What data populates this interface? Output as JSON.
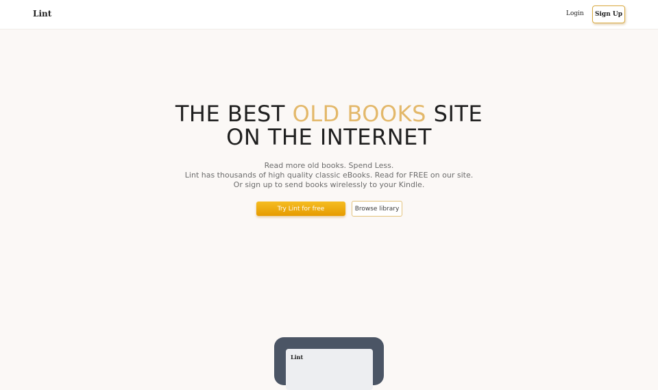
{
  "header": {
    "brand": "Lint",
    "login_label": "Login",
    "signup_label": "Sign Up"
  },
  "hero": {
    "title_part1": "THE BEST ",
    "title_accent": "OLD BOOKS",
    "title_part2": " SITE",
    "title_line2": "ON THE INTERNET",
    "subtitle_lines": [
      "Read more old books. Spend Less.",
      "Lint has thousands of high quality classic eBooks. Read for FREE on our site.",
      "Or sign up to send books wirelessly to your Kindle."
    ],
    "primary_cta": "Try Lint for free",
    "secondary_cta": "Browse library"
  },
  "device": {
    "screen_brand": "Lint"
  },
  "colors": {
    "accent": "#e3b86a",
    "primary_button": "#f0ad12",
    "background": "#fbf8f6"
  }
}
